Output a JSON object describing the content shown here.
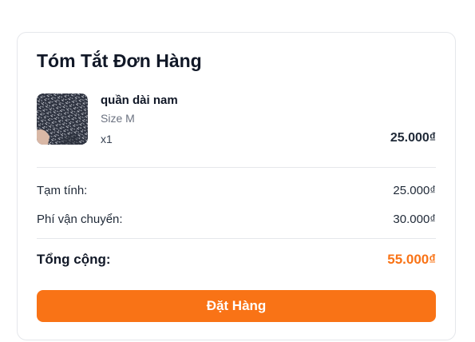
{
  "summary": {
    "title": "Tóm Tắt Đơn Hàng",
    "items": [
      {
        "name": "quần dài nam",
        "variant": "Size M",
        "quantity": "x1",
        "price": "25.000₫"
      }
    ],
    "subtotal": {
      "label": "Tạm tính:",
      "value": "25.000₫"
    },
    "shipping": {
      "label": "Phí vận chuyển:",
      "value": "30.000₫"
    },
    "total": {
      "label": "Tổng cộng:",
      "value": "55.000₫"
    },
    "button_label": "Đặt Hàng"
  },
  "colors": {
    "accent": "#f97316",
    "text": "#111827",
    "muted": "#6b7280",
    "border": "#e5e7eb"
  }
}
